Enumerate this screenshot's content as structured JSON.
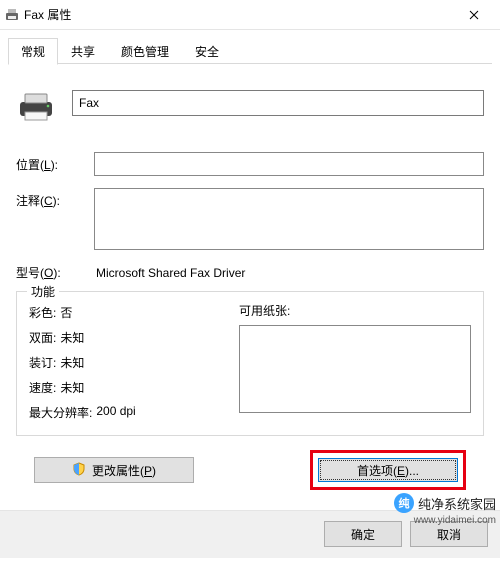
{
  "window": {
    "title": "Fax 属性"
  },
  "tabs": {
    "general": "常规",
    "sharing": "共享",
    "colormgmt": "颜色管理",
    "security": "安全"
  },
  "main": {
    "name_value": "Fax",
    "location_label": "位置(",
    "location_key": "L",
    "location_label_end": "):",
    "location_value": "",
    "comment_label": "注释(",
    "comment_key": "C",
    "comment_label_end": "):",
    "comment_value": "",
    "model_label": "型号(",
    "model_key": "O",
    "model_label_end": "):",
    "model_value": "Microsoft Shared Fax Driver"
  },
  "features": {
    "legend": "功能",
    "color_label": "彩色:",
    "color_value": "否",
    "duplex_label": "双面:",
    "duplex_value": "未知",
    "staple_label": "装订:",
    "staple_value": "未知",
    "speed_label": "速度:",
    "speed_value": "未知",
    "maxres_label": "最大分辨率:",
    "maxres_value": "200 dpi",
    "paper_label": "可用纸张:"
  },
  "buttons": {
    "change": "更改属性(",
    "change_key": "P",
    "change_end": ")",
    "preferences": "首选项(",
    "preferences_key": "E",
    "preferences_end": ")...",
    "ok": "确定",
    "cancel": "取消"
  },
  "watermark": {
    "brand": "纯净系统家园",
    "url": "www.yidaimei.com"
  }
}
